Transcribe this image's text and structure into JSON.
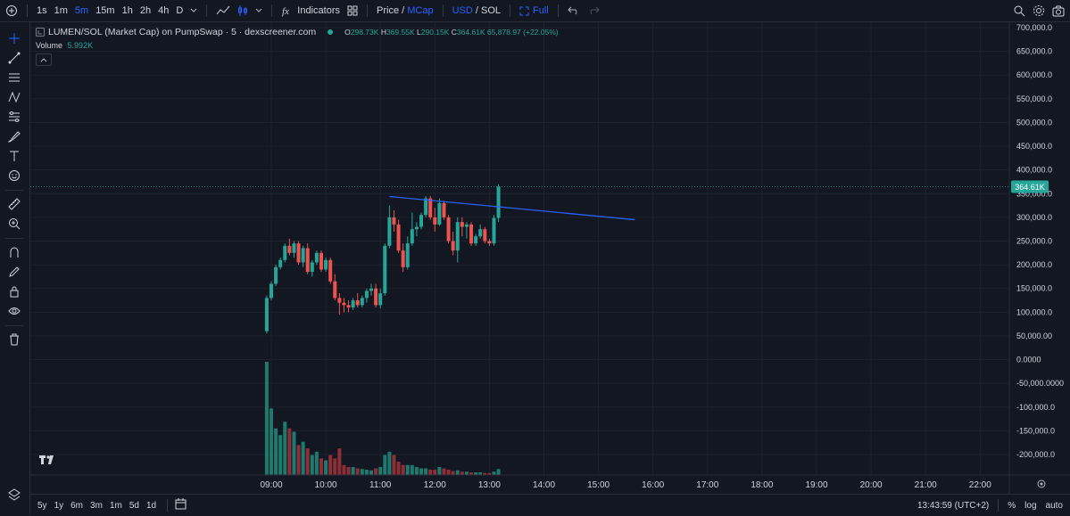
{
  "topbar": {
    "add_symbol_icon": "plus-circle-icon",
    "intervals": [
      "1s",
      "1m",
      "5m",
      "15m",
      "1h",
      "2h",
      "4h",
      "D"
    ],
    "active_interval": "5m",
    "chart_type_icon": "line-chart-icon",
    "candles_icon": "candles-icon",
    "indicators_label": "Indicators",
    "price_label": "Price",
    "slash": "/",
    "mcap_label": "MCap",
    "usd_label": "USD",
    "sol_label": "SOL",
    "full_label": "Full",
    "undo_icon": "undo-icon",
    "redo_icon": "redo-icon"
  },
  "legend": {
    "symbol": "LUMEN/SOL (Market Cap) on PumpSwap · 5 · dexscreener.com",
    "o_label": "O",
    "o_value": "298.73K",
    "h_label": "H",
    "h_value": "369.55K",
    "l_label": "L",
    "l_value": "290.15K",
    "c_label": "C",
    "c_value": "364.61K",
    "change": "65,878.97 (+22.05%)",
    "volume_label": "Volume",
    "volume_value": "5.992K"
  },
  "colors": {
    "background": "#131722",
    "up": "#26a69a",
    "down": "#ef5350",
    "vol_up": "#1e7a6e",
    "vol_down": "#8e2f38",
    "trendline": "#2962ff",
    "grid": "#1e222d",
    "text": "#d1d4dc"
  },
  "price_axis": {
    "ticks": [
      "700,000.0",
      "650,000.0",
      "600,000.0",
      "550,000.0",
      "500,000.0",
      "450,000.0",
      "400,000.0",
      "350,000.0",
      "300,000.0",
      "250,000.0",
      "200,000.0",
      "150,000.0",
      "100,000.0",
      "50,000.00",
      "0.0000",
      "-50,000.0000",
      "-100,000.0",
      "-150,000.0",
      "-200,000.0"
    ],
    "tick_values": [
      700000,
      650000,
      600000,
      550000,
      500000,
      450000,
      400000,
      350000,
      300000,
      250000,
      200000,
      150000,
      100000,
      50000,
      0,
      -50000,
      -100000,
      -150000,
      -200000
    ],
    "current_price_label": "364.61K",
    "current_price_value": 364610
  },
  "time_axis": {
    "labels": [
      "09:00",
      "10:00",
      "11:00",
      "12:00",
      "13:00",
      "14:00",
      "15:00",
      "16:00",
      "17:00",
      "18:00",
      "19:00",
      "20:00",
      "21:00",
      "22:00"
    ]
  },
  "bottombar": {
    "ranges": [
      "5y",
      "1y",
      "6m",
      "3m",
      "1m",
      "5d",
      "1d"
    ],
    "calendar_icon": "calendar-icon",
    "clock": "13:43:59 (UTC+2)",
    "percent_label": "%",
    "log_label": "log",
    "auto_label": "auto"
  },
  "chart_data": {
    "type": "candlestick",
    "interval": "5m",
    "first_candle_time": "08:55",
    "trendline": {
      "start": {
        "time": "11:10",
        "price": 344000
      },
      "end": {
        "time": "15:40",
        "price": 295000
      }
    },
    "candles": [
      [
        60000,
        135000,
        55000,
        130000,
        170000
      ],
      [
        130000,
        165000,
        125000,
        160000,
        100000
      ],
      [
        160000,
        200000,
        155000,
        195000,
        70000
      ],
      [
        195000,
        215000,
        190000,
        210000,
        60000
      ],
      [
        210000,
        245000,
        205000,
        240000,
        80000
      ],
      [
        240000,
        255000,
        220000,
        225000,
        70000
      ],
      [
        225000,
        250000,
        215000,
        245000,
        65000
      ],
      [
        245000,
        250000,
        200000,
        205000,
        45000
      ],
      [
        205000,
        240000,
        195000,
        235000,
        50000
      ],
      [
        235000,
        245000,
        180000,
        185000,
        40000
      ],
      [
        185000,
        210000,
        175000,
        205000,
        30000
      ],
      [
        205000,
        230000,
        200000,
        225000,
        35000
      ],
      [
        225000,
        230000,
        185000,
        190000,
        25000
      ],
      [
        190000,
        215000,
        185000,
        210000,
        22000
      ],
      [
        210000,
        215000,
        160000,
        165000,
        30000
      ],
      [
        165000,
        180000,
        125000,
        130000,
        25000
      ],
      [
        130000,
        140000,
        95000,
        120000,
        40000
      ],
      [
        120000,
        130000,
        100000,
        115000,
        15000
      ],
      [
        115000,
        125000,
        100000,
        110000,
        12000
      ],
      [
        110000,
        130000,
        105000,
        125000,
        12000
      ],
      [
        125000,
        140000,
        110000,
        115000,
        10000
      ],
      [
        115000,
        135000,
        110000,
        130000,
        9000
      ],
      [
        130000,
        150000,
        120000,
        145000,
        8000
      ],
      [
        145000,
        160000,
        135000,
        150000,
        7000
      ],
      [
        150000,
        160000,
        110000,
        115000,
        10000
      ],
      [
        115000,
        150000,
        108000,
        140000,
        12000
      ],
      [
        140000,
        245000,
        135000,
        240000,
        30000
      ],
      [
        240000,
        325000,
        235000,
        300000,
        35000
      ],
      [
        300000,
        315000,
        270000,
        285000,
        30000
      ],
      [
        285000,
        295000,
        225000,
        230000,
        20000
      ],
      [
        230000,
        245000,
        185000,
        195000,
        15000
      ],
      [
        195000,
        260000,
        190000,
        245000,
        15000
      ],
      [
        245000,
        310000,
        240000,
        275000,
        15000
      ],
      [
        275000,
        290000,
        260000,
        280000,
        12000
      ],
      [
        280000,
        310000,
        275000,
        305000,
        10000
      ],
      [
        305000,
        345000,
        300000,
        340000,
        10000
      ],
      [
        340000,
        345000,
        295000,
        300000,
        8000
      ],
      [
        300000,
        320000,
        270000,
        285000,
        8000
      ],
      [
        285000,
        340000,
        282000,
        330000,
        12000
      ],
      [
        330000,
        335000,
        295000,
        300000,
        10000
      ],
      [
        300000,
        305000,
        245000,
        250000,
        8000
      ],
      [
        250000,
        270000,
        220000,
        230000,
        6000
      ],
      [
        230000,
        300000,
        205000,
        290000,
        7000
      ],
      [
        290000,
        300000,
        260000,
        280000,
        5000
      ],
      [
        280000,
        290000,
        255000,
        285000,
        5000
      ],
      [
        285000,
        290000,
        240000,
        245000,
        4000
      ],
      [
        245000,
        265000,
        240000,
        260000,
        4000
      ],
      [
        260000,
        285000,
        255000,
        275000,
        4000
      ],
      [
        275000,
        280000,
        245000,
        250000,
        3000
      ],
      [
        250000,
        255000,
        240000,
        245000,
        3000
      ],
      [
        245000,
        305000,
        240000,
        298730,
        5000
      ],
      [
        298730,
        369550,
        290150,
        364610,
        9000
      ]
    ]
  }
}
